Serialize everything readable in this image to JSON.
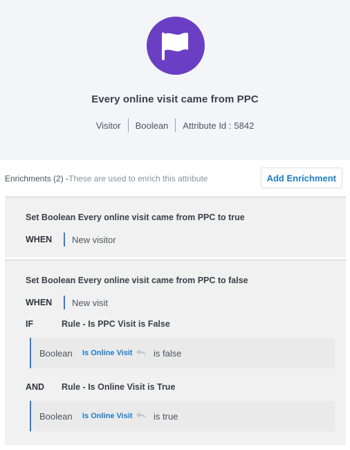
{
  "attribute": {
    "title": "Every online visit came from PPC",
    "entity": "Visitor",
    "type": "Boolean",
    "id_label": "Attribute Id :",
    "id_value": "5842",
    "icon": "flag-icon",
    "accent_color": "#6a3fc3"
  },
  "enrichments": {
    "label": "Enrichments (2) -",
    "hint": "These are used to enrich this attribute",
    "add_button": "Add Enrichment",
    "items": [
      {
        "title": "Set Boolean Every online visit came from PPC to true",
        "when_keyword": "WHEN",
        "when_value": "New visitor"
      },
      {
        "title": "Set Boolean Every online visit came from PPC to false",
        "when_keyword": "WHEN",
        "when_value": "New visit",
        "rules": [
          {
            "keyword": "IF",
            "name": "Rule - Is PPC Visit is False",
            "condition": {
              "type": "Boolean",
              "field": "Is Online Visit",
              "operator": "is false"
            }
          },
          {
            "keyword": "AND",
            "name": "Rule - Is Online Visit is True",
            "condition": {
              "type": "Boolean",
              "field": "Is Online Visit",
              "operator": "is true"
            }
          }
        ]
      }
    ]
  }
}
